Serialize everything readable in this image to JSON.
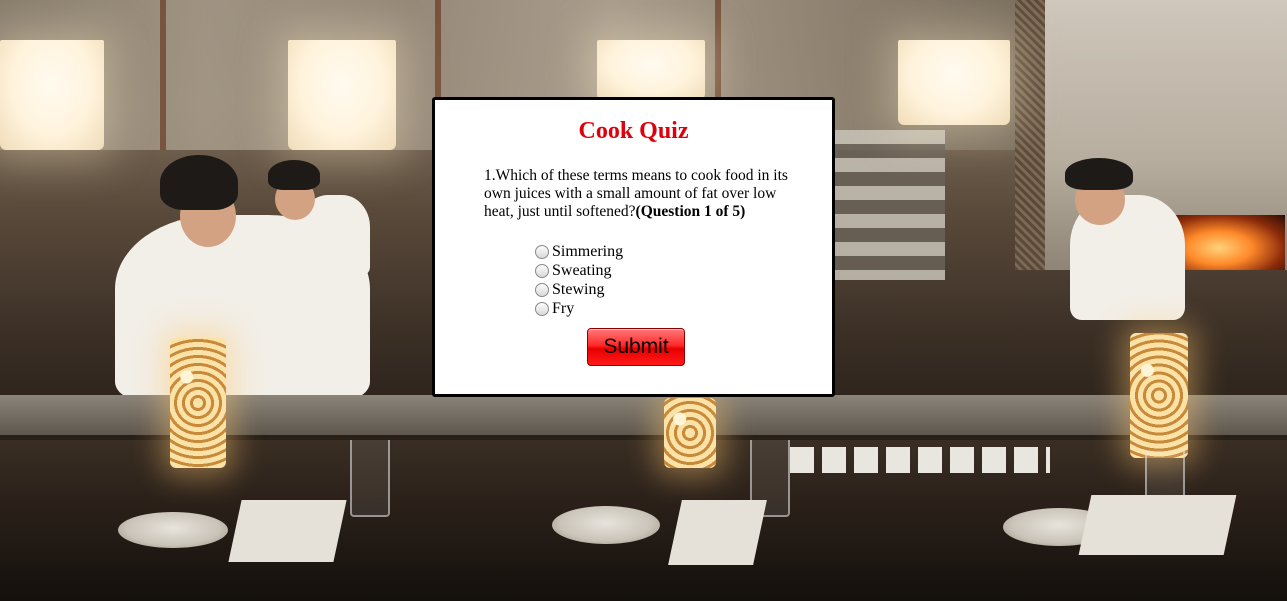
{
  "quiz": {
    "title": "Cook Quiz",
    "question_text": "1.Which of these terms means to cook food in its own juices with a small amount of fat over low heat, just until softened?",
    "question_progress": "(Question 1 of 5)",
    "options": [
      {
        "label": "Simmering",
        "selected": false
      },
      {
        "label": "Sweating",
        "selected": false
      },
      {
        "label": "Stewing",
        "selected": false
      },
      {
        "label": "Fry",
        "selected": false
      }
    ],
    "submit_label": "Submit",
    "title_color": "#e0000b",
    "submit_color": "#ff1a1a"
  },
  "background": {
    "scene": "restaurant-kitchen-photo"
  }
}
